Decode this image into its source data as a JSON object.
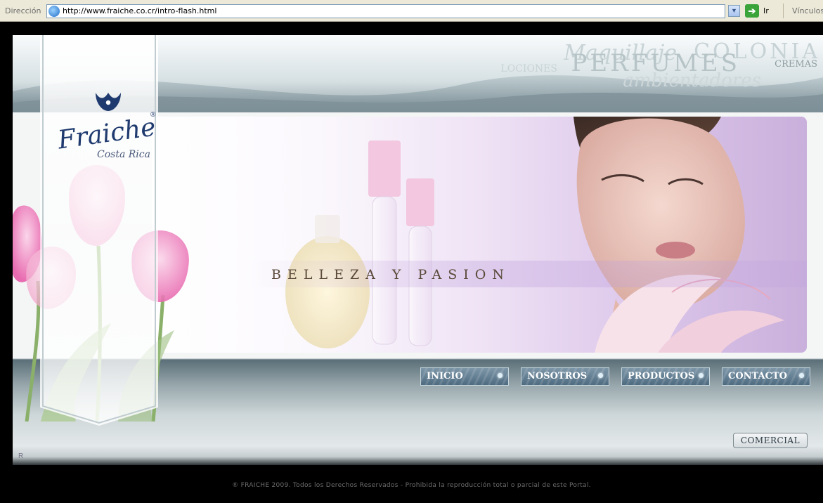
{
  "browser": {
    "address_label": "Dirección",
    "url": "http://www.fraiche.co.cr/intro-flash.html",
    "go_label": "Ir",
    "links_label": "Vínculos"
  },
  "header": {
    "background_words": {
      "maquillaje": "Maquillaje",
      "colonia": "COLONIA",
      "perfumes": "PERFUMES",
      "lociones": "LOCIONES",
      "cremas": "CREMAS",
      "ambientadores": "ambientadores"
    }
  },
  "logo": {
    "brand": "Fraiche",
    "registered": "®",
    "location": "Costa Rica"
  },
  "hero": {
    "tagline": "BELLEZA Y PASION"
  },
  "nav": {
    "items": [
      {
        "label": "INICIO"
      },
      {
        "label": "NOSOTROS"
      },
      {
        "label": "PRODUCTOS"
      },
      {
        "label": "CONTACTO"
      }
    ],
    "comercial": "COMERCIAL"
  },
  "stage": {
    "corner_mark": "R"
  },
  "footer": {
    "copyright": "® FRAICHE 2009. Todos los Derechos Reservados - Prohibida la reproducción total o parcial de este Portal."
  },
  "colors": {
    "brand_navy": "#1f3a6e",
    "nav_button": "#5b7689",
    "hero_lavender": "#dcc6ea"
  }
}
